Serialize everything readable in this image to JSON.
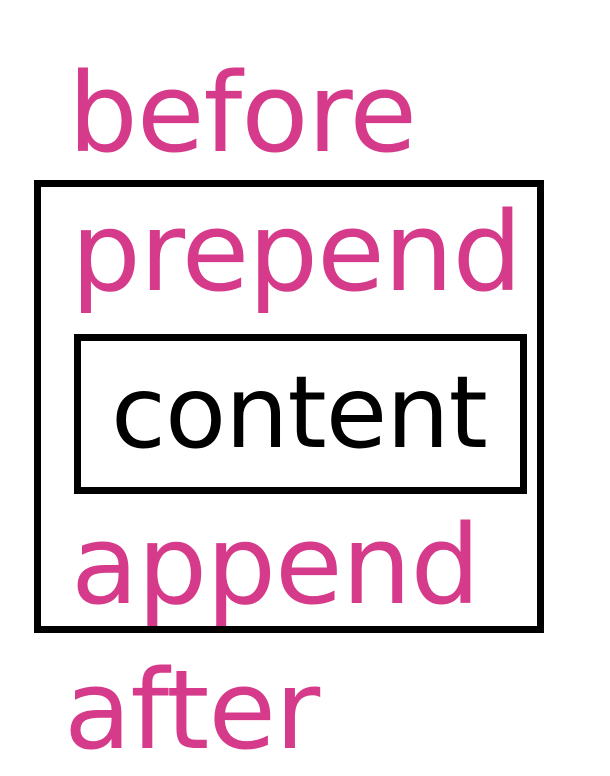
{
  "labels": {
    "before": "before",
    "prepend": "prepend",
    "content": "content",
    "append": "append",
    "after": "after"
  },
  "colors": {
    "accent": "#d63a8a",
    "border": "#000000",
    "content_text": "#000000"
  }
}
